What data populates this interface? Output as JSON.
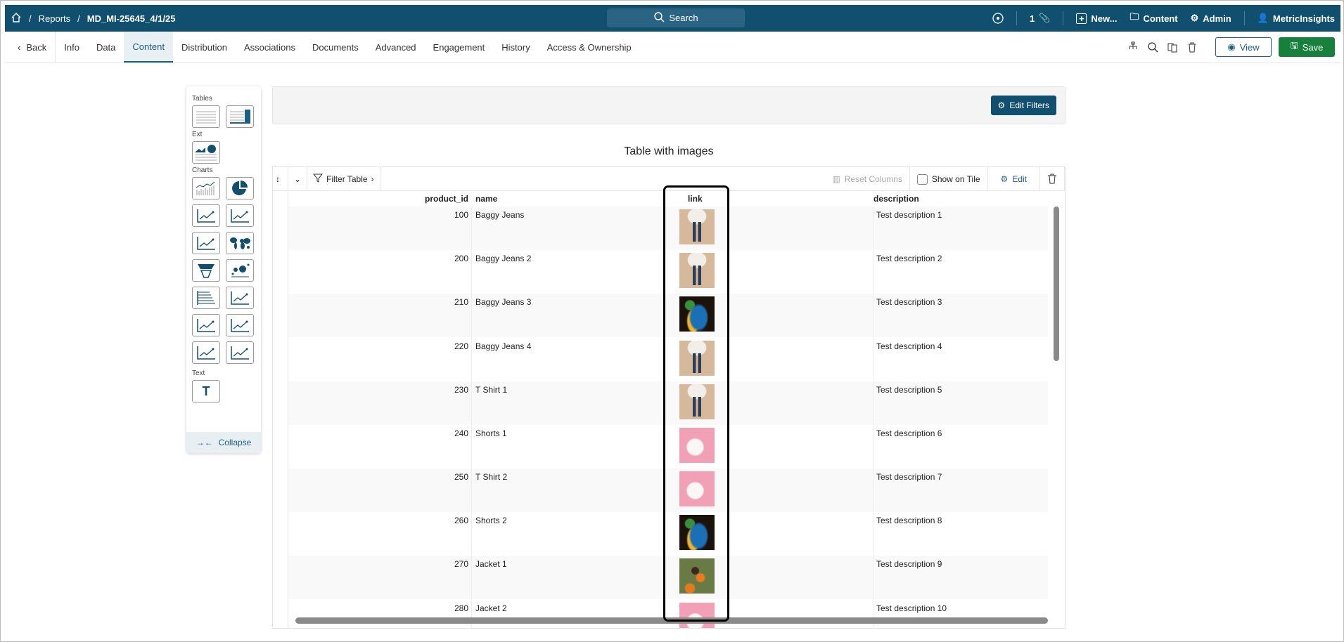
{
  "topbar": {
    "breadcrumb": [
      "Reports",
      "MD_MI-25645_4/1/25"
    ],
    "search": "Search",
    "count": "1",
    "new": "New...",
    "content": "Content",
    "admin": "Admin",
    "user": "MetricInsights"
  },
  "tabs": {
    "back": "Back",
    "items": [
      "Info",
      "Data",
      "Content",
      "Distribution",
      "Associations",
      "Documents",
      "Advanced",
      "Engagement",
      "History",
      "Access & Ownership"
    ],
    "active": "Content",
    "view": "View",
    "save": "Save"
  },
  "palette": {
    "tables": "Tables",
    "ext": "Ext",
    "charts": "Charts",
    "text": "Text",
    "collapse": "Collapse"
  },
  "filters": {
    "edit_filters": "Edit Filters"
  },
  "table": {
    "title": "Table with images",
    "filter_table": "Filter Table",
    "reset_columns": "Reset Columns",
    "show_on_tile": "Show on Tile",
    "edit": "Edit",
    "columns": [
      "product_id",
      "name",
      "link",
      "description"
    ],
    "rows": [
      {
        "product_id": "100",
        "name": "Baggy Jeans",
        "image": "jeans",
        "description": "Test description 1"
      },
      {
        "product_id": "200",
        "name": "Baggy Jeans 2",
        "image": "jeans",
        "description": "Test description 2"
      },
      {
        "product_id": "210",
        "name": "Baggy Jeans 3",
        "image": "parrot",
        "description": "Test description 3"
      },
      {
        "product_id": "220",
        "name": "Baggy Jeans 4",
        "image": "jeans",
        "description": "Test description 4"
      },
      {
        "product_id": "230",
        "name": "T Shirt 1",
        "image": "jeans",
        "description": "Test description 5"
      },
      {
        "product_id": "240",
        "name": "Shorts 1",
        "image": "kitten",
        "description": "Test description 6"
      },
      {
        "product_id": "250",
        "name": "T Shirt 2",
        "image": "kitten",
        "description": "Test description 7"
      },
      {
        "product_id": "260",
        "name": "Shorts 2",
        "image": "parrot",
        "description": "Test description 8"
      },
      {
        "product_id": "270",
        "name": "Jacket 1",
        "image": "butterfly",
        "description": "Test description 9"
      },
      {
        "product_id": "280",
        "name": "Jacket 2",
        "image": "kitten",
        "description": "Test description 10"
      }
    ]
  }
}
